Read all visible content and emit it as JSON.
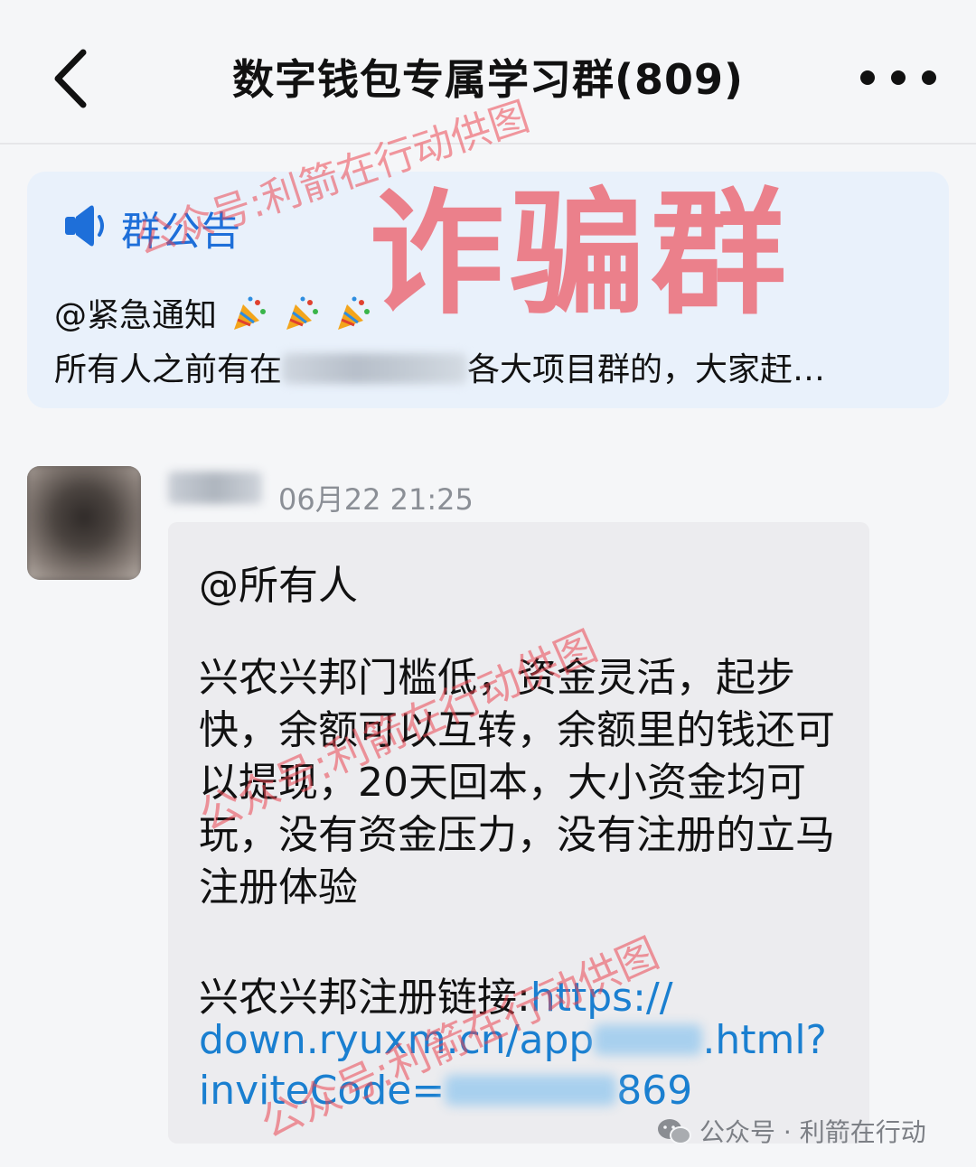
{
  "header": {
    "title": "数字钱包专属学习群(809)",
    "back_icon": "chevron-left-icon",
    "more_icon": "more-dots-icon"
  },
  "notice": {
    "title": "群公告",
    "icon": "speaker-icon",
    "line1": "@紧急通知",
    "line2_prefix": "所有人之前有在",
    "line2_suffix": "各大项目群的，大家赶…"
  },
  "message": {
    "time": "06月22 21:25",
    "mention": "@所有人",
    "body": "兴农兴邦门槛低，资金灵活，起步快，余额可以互转，余额里的钱还可以提现，20天回本，大小资金均可玩，没有资金压力，没有注册的立马注册体验",
    "link_label": "兴农兴邦注册链接:",
    "link_line1": "https://",
    "link_line2a": "down.ryuxm.cn/app",
    "link_line2b": ".html?",
    "link_line3a": "inviteCode=",
    "link_line3b": "869"
  },
  "overlay": {
    "stamp": "诈骗群",
    "watermark_text": "公众号:利箭在行动供图",
    "source_tag": "公众号 · 利箭在行动"
  },
  "colors": {
    "accent_blue": "#1e6fd9",
    "link_blue": "#1a7fd0",
    "stamp_red": "#ec5460",
    "notice_bg": "#e9f1fb",
    "bubble_bg": "#ececef"
  }
}
